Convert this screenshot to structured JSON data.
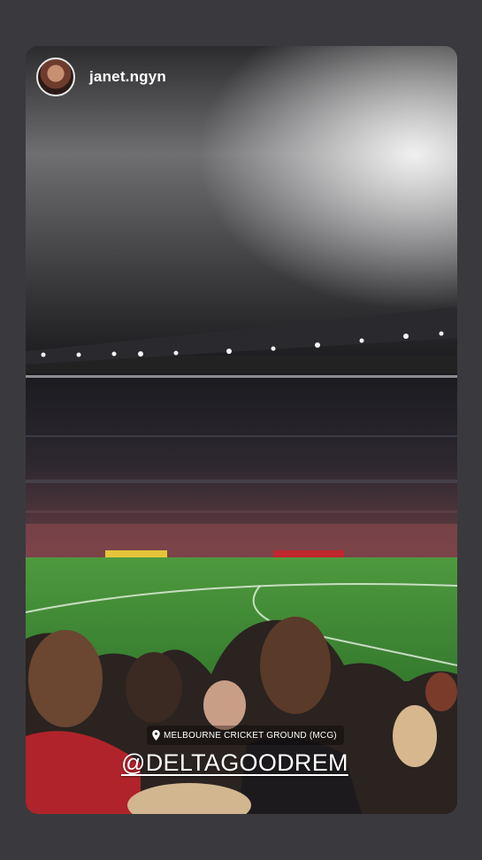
{
  "story": {
    "username": "janet.ngyn",
    "location_sticker": "MELBOURNE CRICKET GROUND (MCG)",
    "mention_sticker": "@DELTAGOODREM"
  },
  "icons": {
    "location": "location-pin-icon",
    "avatar": "profile-avatar"
  },
  "colors": {
    "frame": "#3a3a3e",
    "text": "#ffffff",
    "pitch": "#3f8a36"
  }
}
